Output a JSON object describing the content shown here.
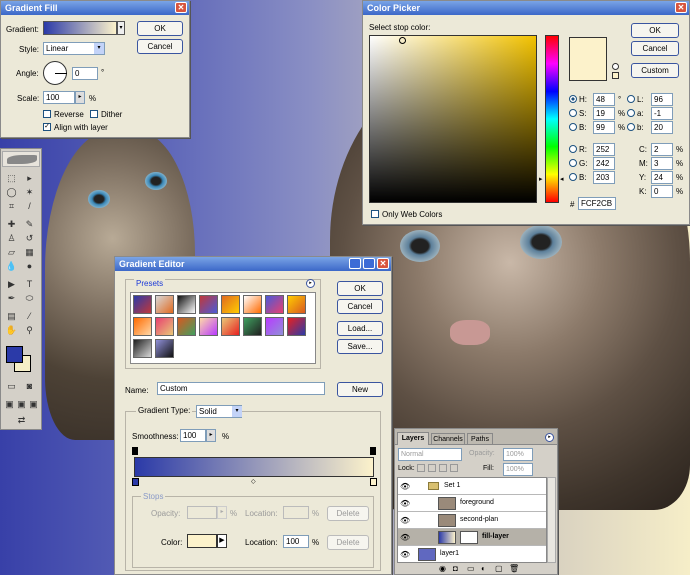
{
  "gradient_fill": {
    "title": "Gradient Fill",
    "gradient_label": "Gradient:",
    "ok": "OK",
    "cancel": "Cancel",
    "style_label": "Style:",
    "style_value": "Linear",
    "angle_label": "Angle:",
    "angle_value": "0",
    "angle_unit": "°",
    "scale_label": "Scale:",
    "scale_value": "100",
    "scale_unit": "%",
    "reverse": "Reverse",
    "dither": "Dither",
    "align": "Align with layer",
    "align_checked": true
  },
  "color_picker": {
    "title": "Color Picker",
    "select_label": "Select stop color:",
    "ok": "OK",
    "cancel": "Cancel",
    "custom": "Custom",
    "only_web": "Only Web Colors",
    "hex_symbol": "#",
    "hex": "FCF2CB",
    "color": "#FCF2CB",
    "hsb": [
      {
        "k": "H:",
        "v": "48",
        "u": "°"
      },
      {
        "k": "S:",
        "v": "19",
        "u": "%"
      },
      {
        "k": "B:",
        "v": "99",
        "u": "%"
      }
    ],
    "rgb": [
      {
        "k": "R:",
        "v": "252"
      },
      {
        "k": "G:",
        "v": "242"
      },
      {
        "k": "B:",
        "v": "203"
      }
    ],
    "lab": [
      {
        "k": "L:",
        "v": "96"
      },
      {
        "k": "a:",
        "v": "-1"
      },
      {
        "k": "b:",
        "v": "20"
      }
    ],
    "cmyk": [
      {
        "k": "C:",
        "v": "2",
        "u": "%"
      },
      {
        "k": "M:",
        "v": "3",
        "u": "%"
      },
      {
        "k": "Y:",
        "v": "24",
        "u": "%"
      },
      {
        "k": "K:",
        "v": "0",
        "u": "%"
      }
    ]
  },
  "gradient_editor": {
    "title": "Gradient Editor",
    "presets_label": "Presets",
    "ok": "OK",
    "cancel": "Cancel",
    "load": "Load...",
    "save": "Save...",
    "name_label": "Name:",
    "name_value": "Custom",
    "new": "New",
    "type_label": "Gradient Type:",
    "type_value": "Solid",
    "smooth_label": "Smoothness:",
    "smooth_value": "100",
    "smooth_unit": "%",
    "stops_label": "Stops",
    "opacity_label": "Opacity:",
    "opacity_unit": "%",
    "location_label": "Location:",
    "location_unit": "%",
    "delete": "Delete",
    "color_label": "Color:",
    "color_location": "100",
    "color_location_unit": "%",
    "delete2": "Delete",
    "preset_colors": [
      "#2b3aa8",
      "#d8d8d8",
      "#111111",
      "#c0383a",
      "#e06a20",
      "#ffffff",
      "#4a5ad8",
      "#ffcc00",
      "#ff6a00",
      "#e84070",
      "#d85820",
      "#ffd8a8",
      "#e8c878",
      "#40a060",
      "#b83aff",
      "#e82020",
      "#202020",
      "#9090d8"
    ]
  },
  "layers": {
    "tabs": [
      "Layers",
      "Channels",
      "Paths"
    ],
    "blend": "Normal",
    "opacity_label": "Opacity:",
    "opacity_value": "100%",
    "lock_label": "Lock:",
    "fill_label": "Fill:",
    "fill_value": "100%",
    "rows": [
      {
        "name": "Set 1"
      },
      {
        "name": "foreground"
      },
      {
        "name": "second-plan"
      },
      {
        "name": "fill-layer"
      },
      {
        "name": "layer1"
      }
    ]
  }
}
